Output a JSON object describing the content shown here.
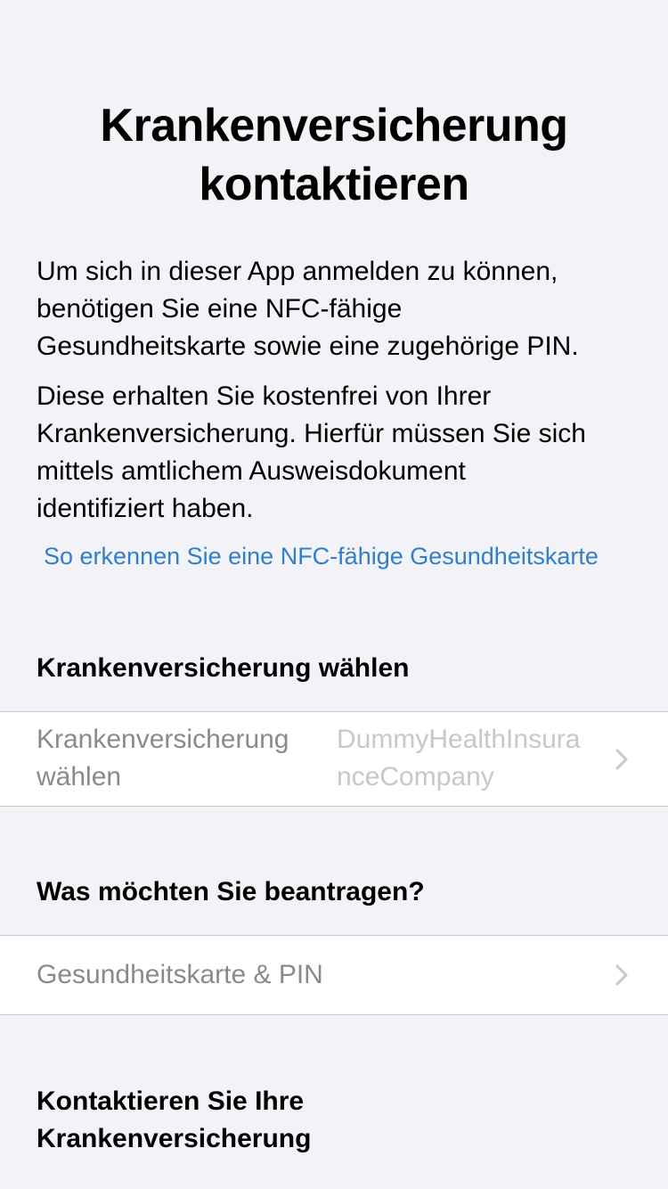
{
  "title": {
    "line1": "Krankenversicherung",
    "line2": "kontaktieren"
  },
  "intro": {
    "paragraph1": [
      "Um sich in dieser App anmelden zu können,",
      "benötigen Sie eine NFC-fähige",
      "Gesundheitskarte sowie eine zugehörige PIN."
    ],
    "paragraph2": [
      "Diese erhalten Sie kostenfrei von Ihrer",
      "Krankenversicherung. Hierfür müssen Sie sich",
      "mittels amtlichem Ausweisdokument",
      "identifiziert haben."
    ],
    "link": "So erkennen Sie eine NFC-fähige Gesundheitskarte"
  },
  "insurance_section": {
    "header": "Krankenversicherung wählen",
    "cell_label": [
      "Krankenversicherung",
      "wählen"
    ],
    "cell_value": [
      "DummyHealthInsura",
      "nceCompany"
    ],
    "chevron_icon": "chevron-right-icon"
  },
  "request_section": {
    "header": "Was möchten Sie beantragen?",
    "cell_label": "Gesundheitskarte & PIN",
    "chevron_icon": "chevron-right-icon"
  },
  "contact_section": {
    "header": [
      "Kontaktieren Sie Ihre",
      "Krankenversicherung"
    ]
  },
  "colors": {
    "background": "#f2f2f7",
    "cell_background": "#ffffff",
    "separator": "#c8c7cc",
    "link": "#2f7fcb",
    "secondary_text": "#8a8a8e",
    "placeholder_text": "#c7c7cc",
    "chevron": "#c7c7cc"
  }
}
